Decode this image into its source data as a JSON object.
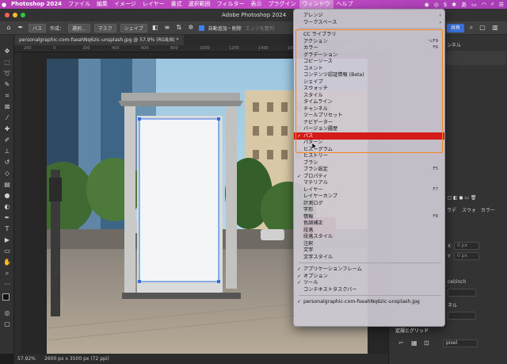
{
  "menubar": {
    "app": "Photoshop 2024",
    "items": [
      "ファイル",
      "編集",
      "イメージ",
      "レイヤー",
      "書式",
      "選択範囲",
      "フィルター",
      "表示",
      "プラグイン",
      "ウィンドウ",
      "ヘルプ"
    ],
    "active": "ウィンドウ",
    "status_text": "あ"
  },
  "window_title": "Adobe Photoshop 2024",
  "options_bar": {
    "tool_preset": "パス",
    "create_label": "作成：",
    "select_button": "選択...",
    "mask_button": "マスク",
    "shape_button": "シェイプ",
    "auto_add_delete": "自動追加・削除",
    "align_edges": "エッジを整列",
    "share_button": "共有"
  },
  "document_tab": "personalgraphic-com-fseahNq6zic-unsplash.jpg @ 57.9% (RGB/8) *",
  "ruler_ticks": [
    "200",
    "0",
    "200",
    "400",
    "600",
    "800",
    "1000",
    "1200",
    "1400",
    "1600",
    "1800",
    "2000",
    "2200"
  ],
  "status_bar": {
    "zoom": "57.92%",
    "doc_info": "2600 px x 3500 px (72 ppi)"
  },
  "panels": {
    "layer_tab_fragment": "ンネル",
    "tabs_fragment": [
      "ラデ",
      "スウォ",
      "カラー"
    ],
    "field_x": "X",
    "field_y": "Y",
    "field_x_value": "0 px",
    "field_y_value": "0 px",
    "unit_fragment": "cel/inch",
    "px_fragment": "ネル",
    "guides_heading": "定規とグリッド",
    "unit_select": "pixel"
  },
  "window_menu": {
    "items": [
      {
        "label": "アレンジ",
        "submenu": true
      },
      {
        "label": "ワークスペース",
        "submenu": true
      },
      {
        "sep": true
      },
      {
        "label": "CC ライブラリ"
      },
      {
        "label": "アクション",
        "shortcut": "⌥F9"
      },
      {
        "label": "カラー",
        "shortcut": "F6"
      },
      {
        "label": "グラデーション"
      },
      {
        "label": "コピーソース"
      },
      {
        "label": "コメント"
      },
      {
        "label": "コンテンツ認証情報 (Beta)"
      },
      {
        "label": "シェイプ"
      },
      {
        "label": "スウォッチ"
      },
      {
        "label": "スタイル"
      },
      {
        "label": "タイムライン"
      },
      {
        "label": "チャンネル"
      },
      {
        "label": "ツールプリセット"
      },
      {
        "label": "ナビゲーター"
      },
      {
        "label": "バージョン履歴"
      },
      {
        "label": "パス",
        "checked": true,
        "selected": true
      },
      {
        "label": "パターン"
      },
      {
        "label": "ヒストグラム"
      },
      {
        "label": "ヒストリー"
      },
      {
        "label": "ブラシ"
      },
      {
        "label": "ブラシ設定",
        "shortcut": "F5"
      },
      {
        "label": "プロパティ",
        "checked": true
      },
      {
        "label": "マテリアル"
      },
      {
        "label": "レイヤー",
        "shortcut": "F7"
      },
      {
        "label": "レイヤーカンプ"
      },
      {
        "label": "計測ログ"
      },
      {
        "label": "字形"
      },
      {
        "label": "情報",
        "shortcut": "F8"
      },
      {
        "label": "色調補正"
      },
      {
        "label": "段落"
      },
      {
        "label": "段落スタイル"
      },
      {
        "label": "注釈"
      },
      {
        "label": "文字"
      },
      {
        "label": "文字スタイル"
      },
      {
        "sep": true
      },
      {
        "label": "アプリケーションフレーム",
        "checked": true
      },
      {
        "label": "オプション",
        "checked": true
      },
      {
        "label": "ツール",
        "checked": true
      },
      {
        "label": "コンテキストタスクバー"
      },
      {
        "sep": true
      },
      {
        "label": "personalgraphic-com-fseahNq6zic-unsplash.jpg",
        "checked": true
      }
    ]
  },
  "colors": {
    "menubar": "#c44bc8",
    "selection": "#d51a1a",
    "highlight_box": "#f5831f",
    "accent": "#3b6fd6"
  }
}
